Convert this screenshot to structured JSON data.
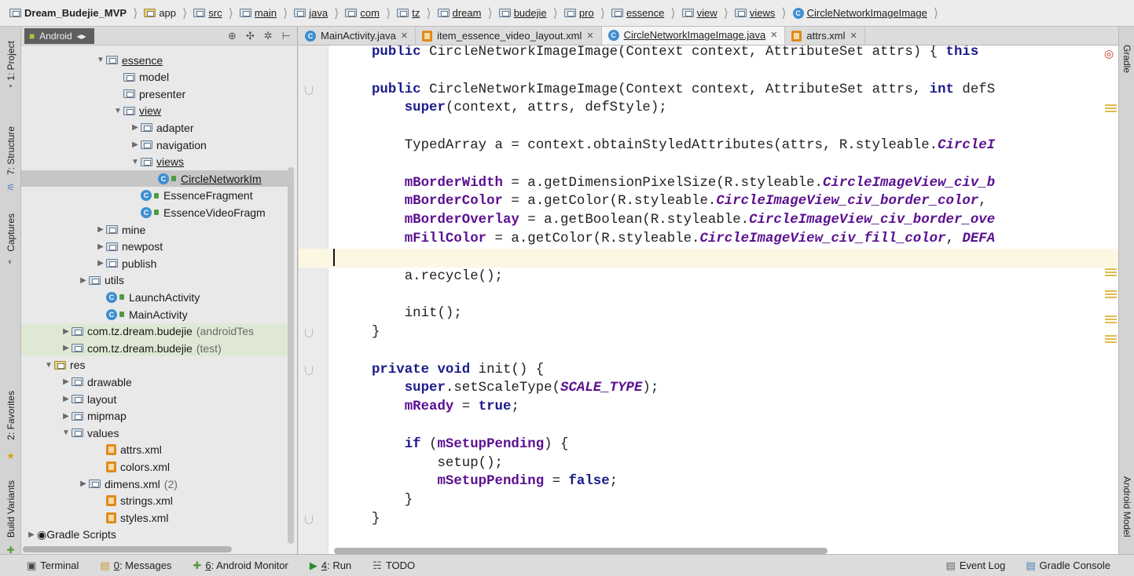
{
  "breadcrumbs": [
    {
      "label": "Dream_Budejie_MVP",
      "icon": "project-folder-icon",
      "underline": false,
      "first": true
    },
    {
      "label": "app",
      "icon": "module-folder-icon",
      "underline": false
    },
    {
      "label": "src",
      "icon": "folder-icon",
      "underline": true
    },
    {
      "label": "main",
      "icon": "folder-icon",
      "underline": true
    },
    {
      "label": "java",
      "icon": "folder-icon",
      "underline": true
    },
    {
      "label": "com",
      "icon": "package-icon",
      "underline": true
    },
    {
      "label": "tz",
      "icon": "package-icon",
      "underline": true
    },
    {
      "label": "dream",
      "icon": "package-icon",
      "underline": true
    },
    {
      "label": "budejie",
      "icon": "package-icon",
      "underline": true
    },
    {
      "label": "pro",
      "icon": "package-icon",
      "underline": true
    },
    {
      "label": "essence",
      "icon": "package-icon",
      "underline": true
    },
    {
      "label": "view",
      "icon": "package-icon",
      "underline": true
    },
    {
      "label": "views",
      "icon": "package-icon",
      "underline": true
    },
    {
      "label": "CircleNetworkImageImage",
      "icon": "class-icon",
      "underline": true
    }
  ],
  "left_tool_windows": [
    {
      "label": "1: Project",
      "icon": "project-icon"
    },
    {
      "label": "7: Structure",
      "icon": "structure-icon"
    },
    {
      "label": "Captures",
      "icon": "captures-icon"
    },
    {
      "label": "2: Favorites",
      "icon": "star-icon"
    },
    {
      "label": "Build Variants",
      "icon": "build-variants-icon"
    }
  ],
  "right_tool_windows": [
    {
      "label": "Gradle",
      "icon": "gradle-icon"
    },
    {
      "label": "Android Model",
      "icon": "android-icon"
    }
  ],
  "project_panel": {
    "view_selector": "Android",
    "toolbar_icons": [
      "sync-icon",
      "collapse-icon",
      "gear-icon",
      "hide-icon"
    ],
    "tree": [
      {
        "indent": 4,
        "arrow": "▼",
        "icon": "folder",
        "label": "essence",
        "underline": true
      },
      {
        "indent": 5,
        "arrow": "",
        "icon": "folder",
        "label": "model"
      },
      {
        "indent": 5,
        "arrow": "",
        "icon": "folder",
        "label": "presenter"
      },
      {
        "indent": 5,
        "arrow": "▼",
        "icon": "folder",
        "label": "view",
        "underline": true
      },
      {
        "indent": 6,
        "arrow": "▶",
        "icon": "folder",
        "label": "adapter"
      },
      {
        "indent": 6,
        "arrow": "▶",
        "icon": "folder",
        "label": "navigation"
      },
      {
        "indent": 6,
        "arrow": "▼",
        "icon": "folder",
        "label": "views",
        "underline": true
      },
      {
        "indent": 7,
        "arrow": "",
        "icon": "class",
        "label": "CircleNetworkIm",
        "underline": true,
        "selected": true
      },
      {
        "indent": 6,
        "arrow": "",
        "icon": "class",
        "label": "EssenceFragment"
      },
      {
        "indent": 6,
        "arrow": "",
        "icon": "class",
        "label": "EssenceVideoFragm"
      },
      {
        "indent": 4,
        "arrow": "▶",
        "icon": "folder",
        "label": "mine"
      },
      {
        "indent": 4,
        "arrow": "▶",
        "icon": "folder",
        "label": "newpost"
      },
      {
        "indent": 4,
        "arrow": "▶",
        "icon": "folder",
        "label": "publish"
      },
      {
        "indent": 3,
        "arrow": "▶",
        "icon": "folder",
        "label": "utils"
      },
      {
        "indent": 4,
        "arrow": "",
        "icon": "class",
        "label": "LaunchActivity"
      },
      {
        "indent": 4,
        "arrow": "",
        "icon": "class",
        "label": "MainActivity"
      },
      {
        "indent": 2,
        "arrow": "▶",
        "icon": "folder",
        "label": "com.tz.dream.budejie",
        "hint": "(androidTes",
        "green": true
      },
      {
        "indent": 2,
        "arrow": "▶",
        "icon": "folder",
        "label": "com.tz.dream.budejie",
        "hint": "(test)",
        "green": true
      },
      {
        "indent": 1,
        "arrow": "▼",
        "icon": "res-folder",
        "label": "res"
      },
      {
        "indent": 2,
        "arrow": "▶",
        "icon": "folder",
        "label": "drawable"
      },
      {
        "indent": 2,
        "arrow": "▶",
        "icon": "folder",
        "label": "layout"
      },
      {
        "indent": 2,
        "arrow": "▶",
        "icon": "folder",
        "label": "mipmap"
      },
      {
        "indent": 2,
        "arrow": "▼",
        "icon": "folder",
        "label": "values"
      },
      {
        "indent": 4,
        "arrow": "",
        "icon": "xml",
        "label": "attrs.xml"
      },
      {
        "indent": 4,
        "arrow": "",
        "icon": "xml",
        "label": "colors.xml"
      },
      {
        "indent": 3,
        "arrow": "▶",
        "icon": "folder",
        "label": "dimens.xml",
        "hint": "(2)"
      },
      {
        "indent": 4,
        "arrow": "",
        "icon": "xml",
        "label": "strings.xml"
      },
      {
        "indent": 4,
        "arrow": "",
        "icon": "xml",
        "label": "styles.xml"
      },
      {
        "indent": 0,
        "arrow": "▶",
        "icon": "gradle",
        "label": "Gradle Scripts"
      }
    ]
  },
  "editor_tabs": [
    {
      "label": "MainActivity.java",
      "icon": "class-icon",
      "active": false
    },
    {
      "label": "item_essence_video_layout.xml",
      "icon": "xml-icon",
      "active": false
    },
    {
      "label": "CircleNetworkImageImage.java",
      "icon": "class-icon",
      "active": true
    },
    {
      "label": "attrs.xml",
      "icon": "xml-icon",
      "active": false
    }
  ],
  "code_lines": [
    [
      [
        "kw",
        "public "
      ],
      [
        "p",
        "CircleNetworkImageImage(Context context, AttributeSet attrs) { "
      ],
      [
        "kw",
        "this"
      ]
    ],
    [],
    [
      [
        "kw",
        "public "
      ],
      [
        "p",
        "CircleNetworkImageImage(Context context, AttributeSet attrs, "
      ],
      [
        "kw",
        "int "
      ],
      [
        "p",
        "defS"
      ]
    ],
    [
      [
        "p",
        "    "
      ],
      [
        "kw",
        "super"
      ],
      [
        "p",
        "(context, attrs, defStyle);"
      ]
    ],
    [],
    [
      [
        "p",
        "    TypedArray a = context.obtainStyledAttributes(attrs, R.styleable."
      ],
      [
        "cst",
        "CircleI"
      ]
    ],
    [],
    [
      [
        "p",
        "    "
      ],
      [
        "fld",
        "mBorderWidth"
      ],
      [
        "p",
        " = a.getDimensionPixelSize(R.styleable."
      ],
      [
        "cst",
        "CircleImageView_civ_b"
      ]
    ],
    [
      [
        "p",
        "    "
      ],
      [
        "fld",
        "mBorderColor"
      ],
      [
        "p",
        " = a.getColor(R.styleable."
      ],
      [
        "cst",
        "CircleImageView_civ_border_color"
      ],
      [
        "p",
        ", "
      ]
    ],
    [
      [
        "p",
        "    "
      ],
      [
        "fld",
        "mBorderOverlay"
      ],
      [
        "p",
        " = a.getBoolean(R.styleable."
      ],
      [
        "cst",
        "CircleImageView_civ_border_ove"
      ]
    ],
    [
      [
        "p",
        "    "
      ],
      [
        "fld",
        "mFillColor"
      ],
      [
        "p",
        " = a.getColor(R.styleable."
      ],
      [
        "cst",
        "CircleImageView_civ_fill_color"
      ],
      [
        "p",
        ", "
      ],
      [
        "cst",
        "DEFA"
      ]
    ],
    [],
    [
      [
        "p",
        "    a.recycle();"
      ]
    ],
    [],
    [
      [
        "p",
        "    init();"
      ]
    ],
    [
      [
        "p",
        "}"
      ]
    ],
    [],
    [
      [
        "kw",
        "private void "
      ],
      [
        "p",
        "init() {"
      ]
    ],
    [
      [
        "p",
        "    "
      ],
      [
        "kw",
        "super"
      ],
      [
        "p",
        ".setScaleType("
      ],
      [
        "cst",
        "SCALE_TYPE"
      ],
      [
        "p",
        ");"
      ]
    ],
    [
      [
        "p",
        "    "
      ],
      [
        "fld",
        "mReady"
      ],
      [
        "p",
        " = "
      ],
      [
        "kw",
        "true"
      ],
      [
        "p",
        ";"
      ]
    ],
    [],
    [
      [
        "p",
        "    "
      ],
      [
        "kw",
        "if "
      ],
      [
        "p",
        "("
      ],
      [
        "fld",
        "mSetupPending"
      ],
      [
        "p",
        ") {"
      ]
    ],
    [
      [
        "p",
        "        setup();"
      ]
    ],
    [
      [
        "p",
        "        "
      ],
      [
        "fld",
        "mSetupPending"
      ],
      [
        "p",
        " = "
      ],
      [
        "kw",
        "false"
      ],
      [
        "p",
        ";"
      ]
    ],
    [
      [
        "p",
        "    }"
      ]
    ],
    [
      [
        "p",
        "}"
      ]
    ]
  ],
  "bottom_tools": [
    {
      "label": "Terminal",
      "num": "",
      "icon": "terminal-icon"
    },
    {
      "label": ": Messages",
      "num": "0",
      "icon": "messages-icon"
    },
    {
      "label": ": Android Monitor",
      "num": "6",
      "icon": "android-monitor-icon"
    },
    {
      "label": ": Run",
      "num": "4",
      "icon": "run-icon"
    },
    {
      "label": "TODO",
      "num": "",
      "icon": "todo-icon"
    }
  ],
  "bottom_tools_right": [
    {
      "label": "Event Log",
      "icon": "event-log-icon"
    },
    {
      "label": "Gradle Console",
      "icon": "gradle-console-icon"
    }
  ]
}
